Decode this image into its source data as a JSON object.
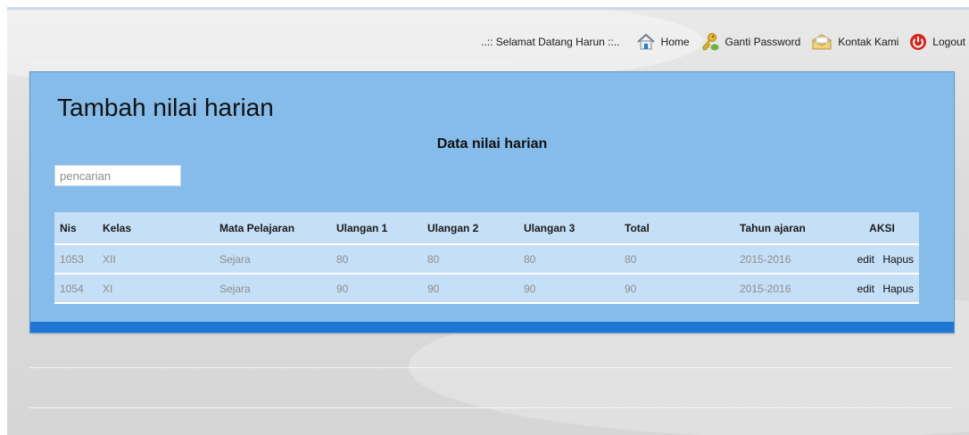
{
  "nav": {
    "welcome": "..:: Selamat Datang Harun ::..",
    "home": "Home",
    "ganti_password": "Ganti Password",
    "kontak_kami": "Kontak Kami",
    "logout": "Logout"
  },
  "panel": {
    "title": "Tambah nilai harian",
    "table_title": "Data nilai harian",
    "search_placeholder": "pencarian"
  },
  "table": {
    "headers": [
      "Nis",
      "Kelas",
      "Mata Pelajaran",
      "Ulangan 1",
      "Ulangan 2",
      "Ulangan 3",
      "Total",
      "Tahun ajaran",
      "AKSI"
    ],
    "rows": [
      {
        "nis": "1053",
        "kelas": "XII",
        "mapel": "Sejara",
        "u1": "80",
        "u2": "80",
        "u3": "80",
        "total": "80",
        "tahun": "2015-2016",
        "edit": "edit",
        "hapus": "Hapus"
      },
      {
        "nis": "1054",
        "kelas": "XI",
        "mapel": "Sejara",
        "u1": "90",
        "u2": "90",
        "u3": "90",
        "total": "90",
        "tahun": "2015-2016",
        "edit": "edit",
        "hapus": "Hapus"
      }
    ]
  },
  "colors": {
    "panel": "#85bce9",
    "panel_footer": "#1c76d2",
    "table_row": "#c4dff6"
  },
  "icons": [
    "home-icon",
    "key-user-icon",
    "envelope-icon",
    "power-icon"
  ]
}
